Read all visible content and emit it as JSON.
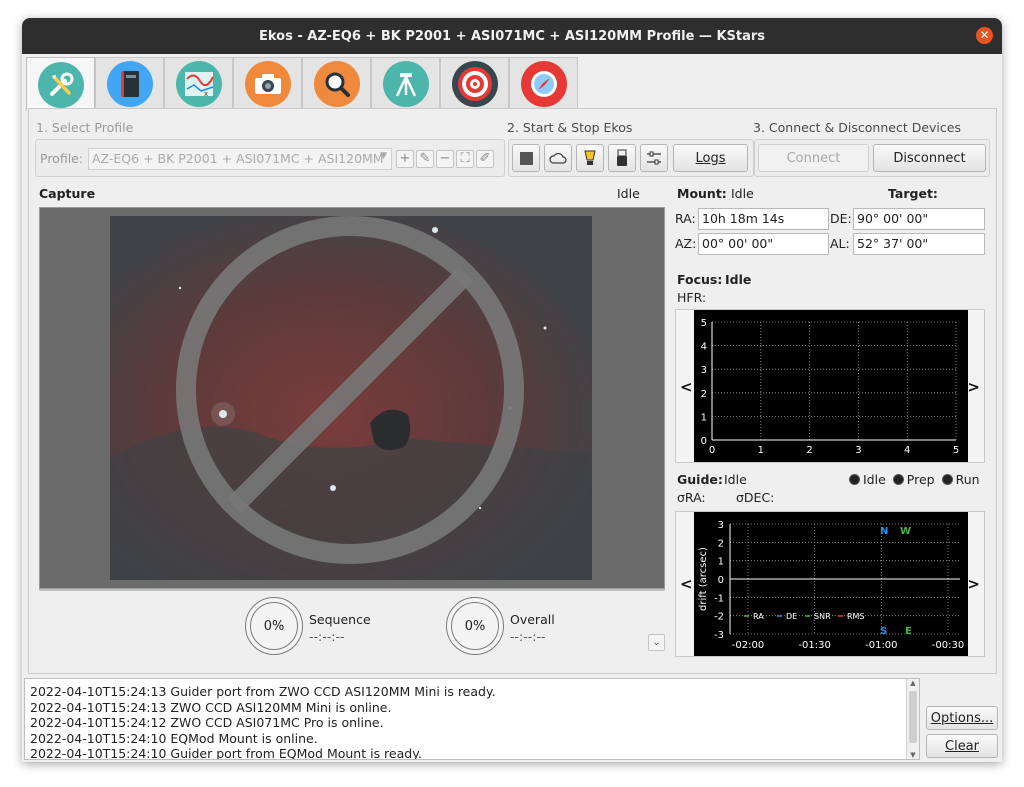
{
  "window": {
    "title": "Ekos - AZ-EQ6 + BK P2001 + ASI071MC + ASI120MM Profile — KStars",
    "close_glyph": "✕"
  },
  "tabs": [
    {
      "name": "setup",
      "icon": "wrench-screwdriver-icon",
      "active": true
    },
    {
      "name": "scheduler",
      "icon": "notebook-icon"
    },
    {
      "name": "analyze",
      "icon": "graph-icon"
    },
    {
      "name": "capture",
      "icon": "camera-icon"
    },
    {
      "name": "focus",
      "icon": "magnifier-icon"
    },
    {
      "name": "mount",
      "icon": "tripod-icon"
    },
    {
      "name": "guide",
      "icon": "target-icon"
    },
    {
      "name": "align",
      "icon": "compass-icon"
    }
  ],
  "profile": {
    "section_label": "1. Select Profile",
    "label": "Profile:",
    "selected": "AZ-EQ6 + BK P2001 + ASI071MC + ASI120MM",
    "buttons": [
      "+",
      "✎",
      "−",
      "⛶",
      "✐"
    ]
  },
  "start_stop": {
    "section_label": "2. Start & Stop Ekos",
    "logs_label": "Logs",
    "icons": [
      "stop-icon",
      "cloud-icon",
      "light-icon",
      "usb-icon",
      "sliders-icon"
    ]
  },
  "connect": {
    "section_label": "3. Connect & Disconnect Devices",
    "connect_label": "Connect",
    "disconnect_label": "Disconnect"
  },
  "capture": {
    "title": "Capture",
    "status": "Idle",
    "sequence_label": "Sequence",
    "sequence_pct": "0%",
    "sequence_time": "--:--:--",
    "overall_label": "Overall",
    "overall_pct": "0%",
    "overall_time": "--:--:--"
  },
  "mount": {
    "label": "Mount:",
    "status": "Idle",
    "target_label": "Target:",
    "ra_label": "RA:",
    "ra": "10h 18m 14s",
    "de_label": "DE:",
    "de": "90° 00' 00\"",
    "az_label": "AZ:",
    "az": "00° 00' 00\"",
    "al_label": "AL:",
    "al": "52° 37' 00\""
  },
  "focus": {
    "label": "Focus:",
    "status": "Idle",
    "hfr_label": "HFR:"
  },
  "guide": {
    "label": "Guide:",
    "status": "Idle",
    "sigma_ra": "σRA:",
    "sigma_dec": "σDEC:",
    "states": [
      "Idle",
      "Prep",
      "Run"
    ],
    "compass": {
      "n": "N",
      "w": "W",
      "s": "S",
      "e": "E"
    }
  },
  "nav": {
    "left": "<",
    "right": ">"
  },
  "log": {
    "lines": [
      "2022-04-10T15:24:13 Guider port from ZWO CCD ASI120MM Mini is ready.",
      "2022-04-10T15:24:13 ZWO CCD ASI120MM Mini is online.",
      "2022-04-10T15:24:12 ZWO CCD ASI071MC Pro is online.",
      "2022-04-10T15:24:10 EQMod Mount is online.",
      "2022-04-10T15:24:10 Guider port from EQMod Mount is ready."
    ],
    "options_label": "Options...",
    "clear_label": "Clear"
  },
  "colors": {
    "accent": "#e95420",
    "plot_bg": "#000000",
    "ra_color": "#4caf50",
    "de_color": "#2196f3",
    "snr_color": "#4caf50",
    "rms_color": "#e53935"
  },
  "chart_data": [
    {
      "type": "scatter",
      "title": "",
      "xlabel": "",
      "ylabel": "",
      "x_ticks": [
        0,
        1,
        2,
        3,
        4,
        5
      ],
      "y_ticks": [
        0,
        1,
        2,
        3,
        4,
        5
      ],
      "xlim": [
        0,
        5
      ],
      "ylim": [
        0,
        5
      ],
      "grid": true,
      "series": []
    },
    {
      "type": "line",
      "title": "",
      "xlabel": "",
      "ylabel": "drift (arcsec)",
      "x_ticks": [
        "-02:00",
        "-01:30",
        "-01:00",
        "-00:30"
      ],
      "y_ticks": [
        -3,
        -2,
        -1,
        0,
        1,
        2,
        3
      ],
      "ylim": [
        -3,
        3
      ],
      "grid": true,
      "legend": [
        "RA",
        "DE",
        "SNR",
        "RMS"
      ],
      "legend_position": "bottom-left",
      "series": []
    }
  ]
}
